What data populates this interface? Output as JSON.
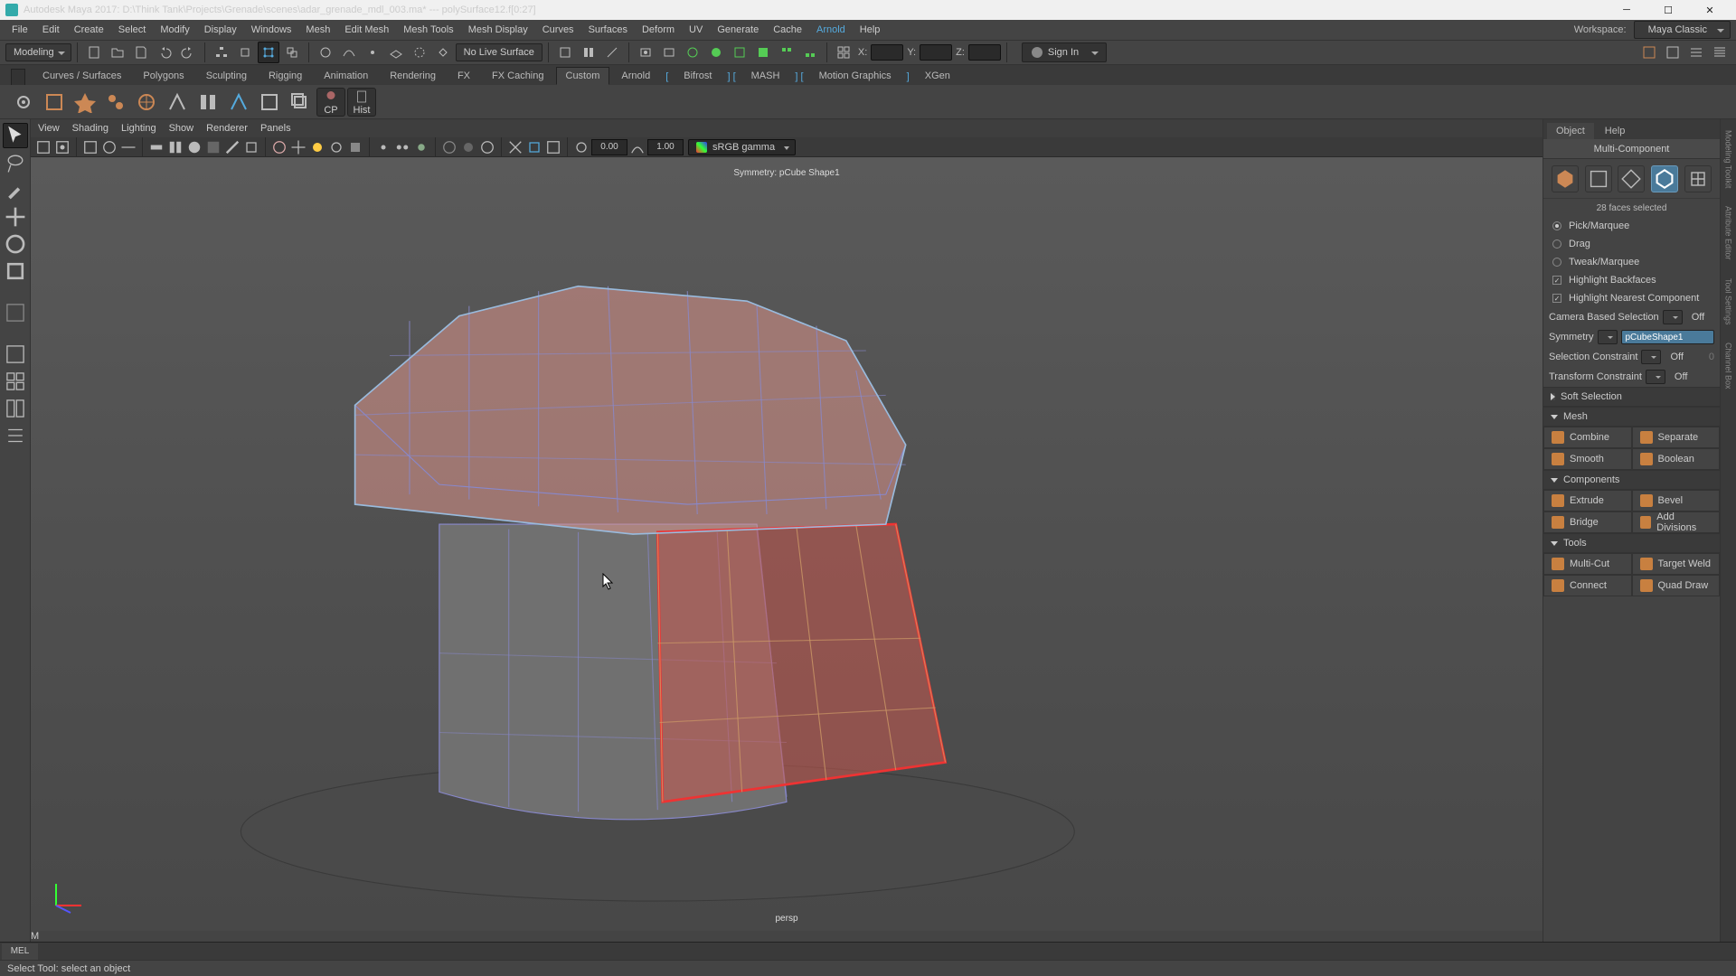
{
  "title": "Autodesk Maya 2017: D:\\Think Tank\\Projects\\Grenade\\scenes\\adar_grenade_mdl_003.ma*  ---  polySurface12.f[0:27]",
  "workspace": {
    "label": "Workspace:",
    "value": "Maya Classic"
  },
  "menubar": [
    "File",
    "Edit",
    "Create",
    "Select",
    "Modify",
    "Display",
    "Windows",
    "Mesh",
    "Edit Mesh",
    "Mesh Tools",
    "Mesh Display",
    "Curves",
    "Surfaces",
    "Deform",
    "UV",
    "Generate",
    "Cache"
  ],
  "menubar_arnold": "Arnold",
  "menubar_help": "Help",
  "modeDropdown": "Modeling",
  "noLiveSurface": "No Live Surface",
  "coords": {
    "x": "X:",
    "y": "Y:",
    "z": "Z:"
  },
  "signin": "Sign In",
  "shelfTabs": [
    "Curves / Surfaces",
    "Polygons",
    "Sculpting",
    "Rigging",
    "Animation",
    "Rendering",
    "FX",
    "FX Caching",
    "Custom",
    "Arnold"
  ],
  "shelfBracketed": [
    "Bifrost",
    "MASH",
    "Motion Graphics"
  ],
  "shelfLast": "XGen",
  "shelfActive": "Custom",
  "shelfButtons": {
    "cp": "CP",
    "hist": "Hist"
  },
  "panelMenu": [
    "View",
    "Shading",
    "Lighting",
    "Show",
    "Renderer",
    "Panels"
  ],
  "panelNums": {
    "a": "0.00",
    "b": "1.00"
  },
  "gamma": "sRGB gamma",
  "viewport": {
    "symmetry": "Symmetry: pCube Shape1",
    "camera": "persp"
  },
  "right": {
    "tabs": [
      "Object",
      "Help"
    ],
    "header": "Multi-Component",
    "selStatus": "28 faces selected",
    "options": [
      {
        "type": "radio",
        "on": true,
        "label": "Pick/Marquee"
      },
      {
        "type": "radio",
        "on": false,
        "label": "Drag"
      },
      {
        "type": "radio",
        "on": false,
        "label": "Tweak/Marquee",
        "dim": true
      },
      {
        "type": "check",
        "on": true,
        "label": "Highlight Backfaces"
      },
      {
        "type": "check",
        "on": true,
        "label": "Highlight Nearest Component"
      }
    ],
    "camSel": {
      "label": "Camera Based Selection",
      "val": "Off"
    },
    "symmetry": {
      "label": "Symmetry",
      "val": "pCubeShape1"
    },
    "selCon": {
      "label": "Selection Constraint",
      "val": "Off",
      "num": "0"
    },
    "transCon": {
      "label": "Transform Constraint",
      "val": "Off"
    },
    "sections": {
      "soft": "Soft Selection",
      "mesh": "Mesh",
      "meshBtns": [
        [
          "Combine",
          "Separate"
        ],
        [
          "Smooth",
          "Boolean"
        ]
      ],
      "comp": "Components",
      "compBtns": [
        [
          "Extrude",
          "Bevel"
        ],
        [
          "Bridge",
          "Add Divisions"
        ]
      ],
      "tools": "Tools",
      "toolsBtns": [
        [
          "Multi-Cut",
          "Target Weld"
        ],
        [
          "Connect",
          "Quad Draw"
        ]
      ]
    }
  },
  "sideTabs": [
    "Modeling Toolkit",
    "Attribute Editor",
    "Tool Settings",
    "Channel Box"
  ],
  "cmd": {
    "lang": "MEL"
  },
  "status": "Select Tool: select an object",
  "chart_data": null
}
